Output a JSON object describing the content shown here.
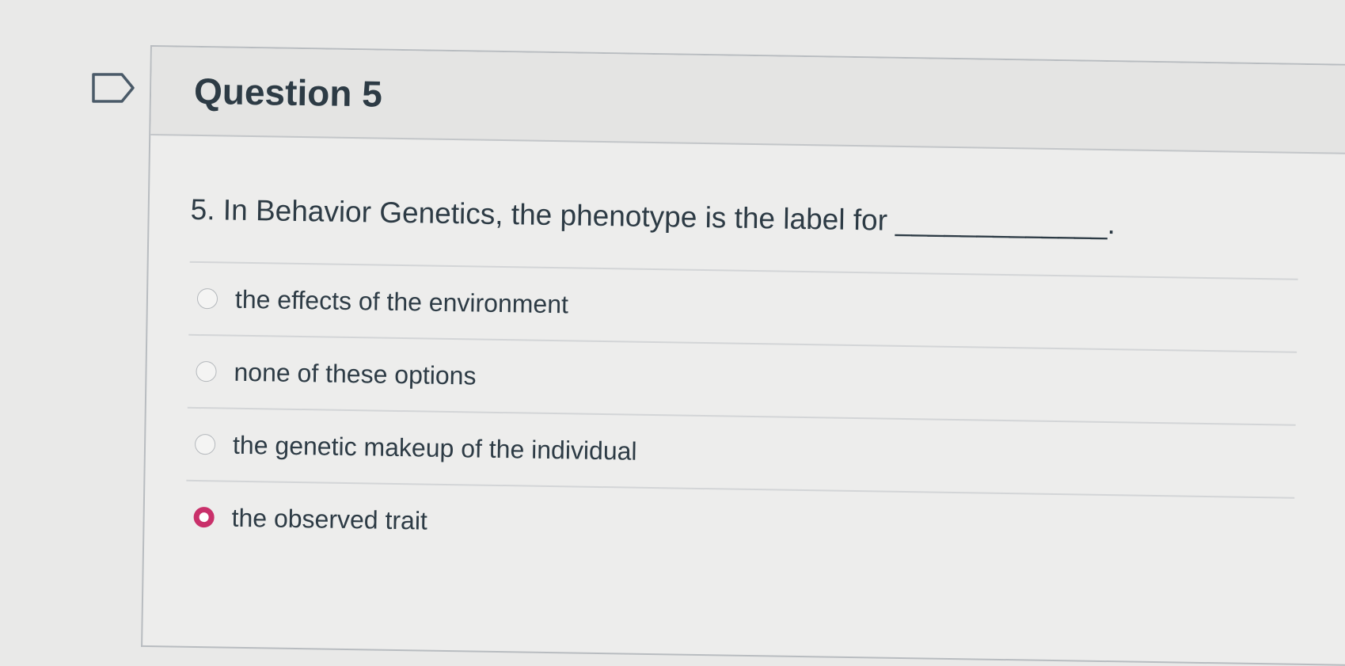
{
  "question": {
    "title": "Question 5",
    "text": "5. In Behavior Genetics, the phenotype is the label for _____________.",
    "answers": [
      {
        "label": "the effects of the environment",
        "selected": false
      },
      {
        "label": "none of these options",
        "selected": false
      },
      {
        "label": "the genetic makeup of the individual",
        "selected": false
      },
      {
        "label": "the observed trait",
        "selected": true
      }
    ]
  },
  "icons": {
    "flag": "flag-question-icon",
    "radio": "radio-button-icon"
  },
  "colors": {
    "accent": "#c9306a",
    "text": "#2d3b45",
    "border": "#b8bcc0"
  }
}
